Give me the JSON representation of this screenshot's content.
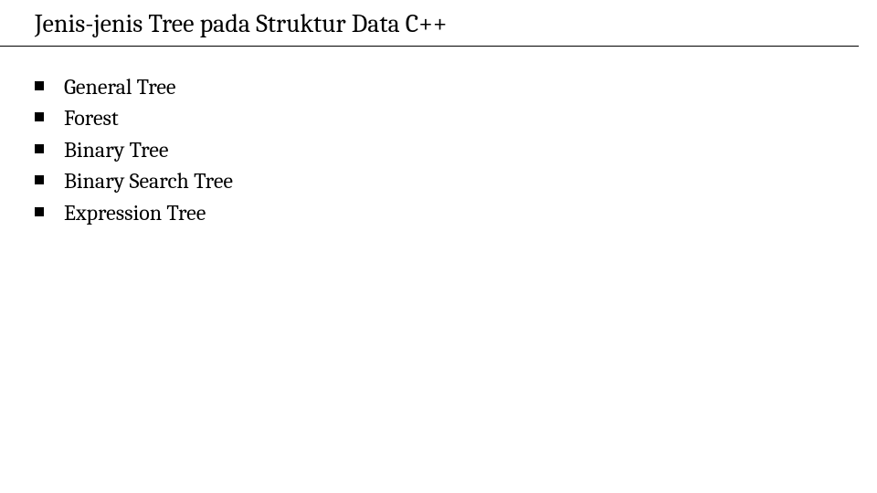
{
  "title": "Jenis-jenis Tree pada Struktur Data C++",
  "items": [
    "General Tree",
    "Forest",
    "Binary Tree",
    "Binary Search Tree",
    "Expression Tree"
  ]
}
